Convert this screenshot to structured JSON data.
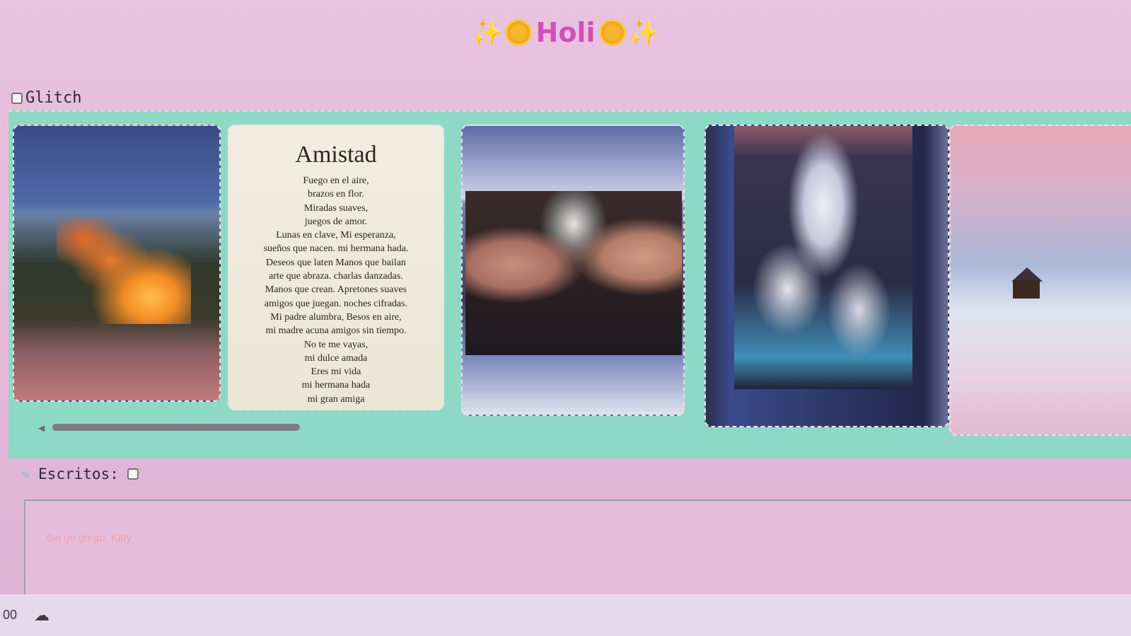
{
  "header": {
    "title": "Holi",
    "sparkle_left": "✨",
    "sparkle_right": "✨"
  },
  "glitch": {
    "label": "Glitch",
    "checked": false
  },
  "poem": {
    "title": "Amistad",
    "lines": [
      "Fuego en el aire,",
      "brazos en flor.",
      "Miradas suaves,",
      "juegos de amor.",
      "Lunas en clave,    Mi esperanza,",
      "sueños que nacen.  mi hermana hada.",
      "Deseos que laten    Manos que bailan",
      "arte que abraza.  charlas danzadas.",
      "Manos que crean.   Apretones suaves",
      "amigos que juegan.  noches cifradas.",
      "Mi padre alumbra,    Besos en aire,",
      "mi madre acuna    amigos sin tiempo.",
      "No te me vayas,",
      "mi dulce amada",
      "Eres mi vida",
      "mi hermana hada",
      "mi gran amiga"
    ]
  },
  "carousel": {
    "items": [
      "lava-photo",
      "poem-card",
      "selfie-photo",
      "robots-photo",
      "snow-church-photo"
    ],
    "scroll_arrow": "◀"
  },
  "escritos": {
    "label": "Escritos:",
    "checked": false,
    "placeholder": "Go go go go; Kitty"
  },
  "statusbar": {
    "left_text": "00",
    "cloud": "☁"
  },
  "colors": {
    "background": "#e6bede",
    "carousel_bg": "#8ed9c6",
    "title": "#d34fb6",
    "sparkle": "#f4c630"
  }
}
